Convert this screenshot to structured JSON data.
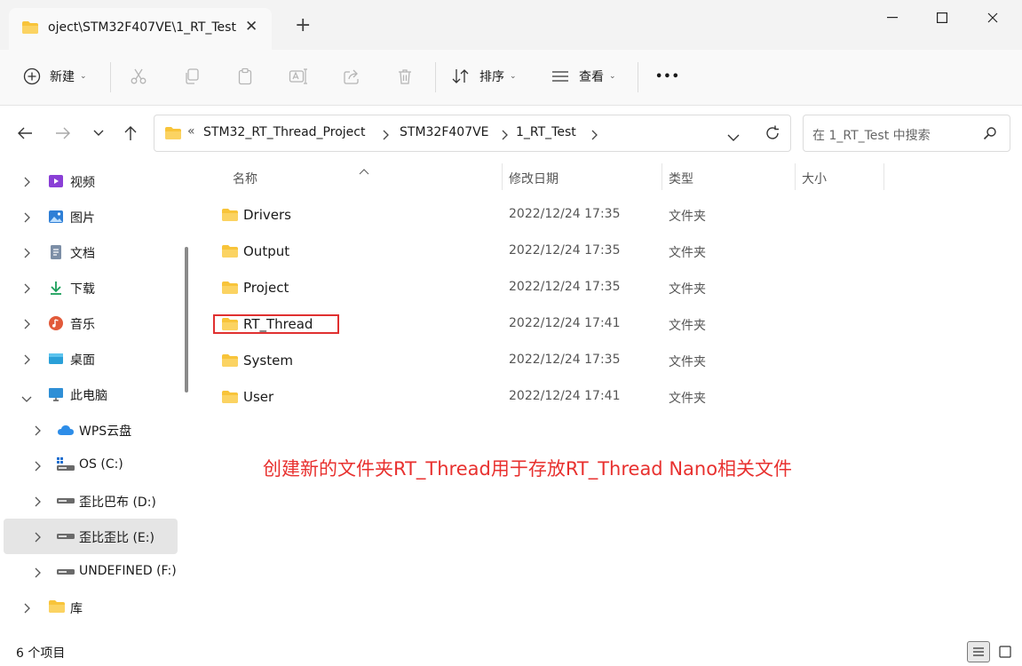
{
  "window": {
    "tab_title": "oject\\STM32F407VE\\1_RT_Test",
    "new_tab": "+"
  },
  "toolbar": {
    "new_label": "新建",
    "sort_label": "排序",
    "view_label": "查看",
    "more_label": "•••"
  },
  "address": {
    "overflow": "«",
    "crumbs": [
      "STM32_RT_Thread_Project",
      "STM32F407VE",
      "1_RT_Test"
    ]
  },
  "search": {
    "placeholder": "在 1_RT_Test 中搜索"
  },
  "sidebar": {
    "items": [
      {
        "label": "视频",
        "icon": "video-icon"
      },
      {
        "label": "图片",
        "icon": "picture-icon"
      },
      {
        "label": "文档",
        "icon": "document-icon"
      },
      {
        "label": "下载",
        "icon": "download-icon"
      },
      {
        "label": "音乐",
        "icon": "music-icon"
      },
      {
        "label": "桌面",
        "icon": "desktop-icon"
      },
      {
        "label": "此电脑",
        "icon": "computer-icon"
      },
      {
        "label": "WPS云盘",
        "icon": "cloud-icon"
      },
      {
        "label": "OS (C:)",
        "icon": "drive-icon"
      },
      {
        "label": "歪比巴布 (D:)",
        "icon": "drive-icon"
      },
      {
        "label": "歪比歪比 (E:)",
        "icon": "drive-icon"
      },
      {
        "label": "UNDEFINED (F:)",
        "icon": "drive-icon"
      },
      {
        "label": "库",
        "icon": "library-icon"
      }
    ]
  },
  "columns": {
    "name": "名称",
    "modified": "修改日期",
    "type": "类型",
    "size": "大小"
  },
  "files": [
    {
      "name": "Drivers",
      "modified": "2022/12/24 17:35",
      "type": "文件夹"
    },
    {
      "name": "Output",
      "modified": "2022/12/24 17:35",
      "type": "文件夹"
    },
    {
      "name": "Project",
      "modified": "2022/12/24 17:35",
      "type": "文件夹"
    },
    {
      "name": "RT_Thread",
      "modified": "2022/12/24 17:41",
      "type": "文件夹"
    },
    {
      "name": "System",
      "modified": "2022/12/24 17:35",
      "type": "文件夹"
    },
    {
      "name": "User",
      "modified": "2022/12/24 17:41",
      "type": "文件夹"
    }
  ],
  "annotation": "创建新的文件夹RT_Thread用于存放RT_Thread Nano相关文件",
  "status": {
    "count": "6 个项目"
  },
  "colors": {
    "folder": "#f8c43a",
    "highlight": "#e03030",
    "annotation": "#e8312f",
    "accent": "#0067c0"
  }
}
